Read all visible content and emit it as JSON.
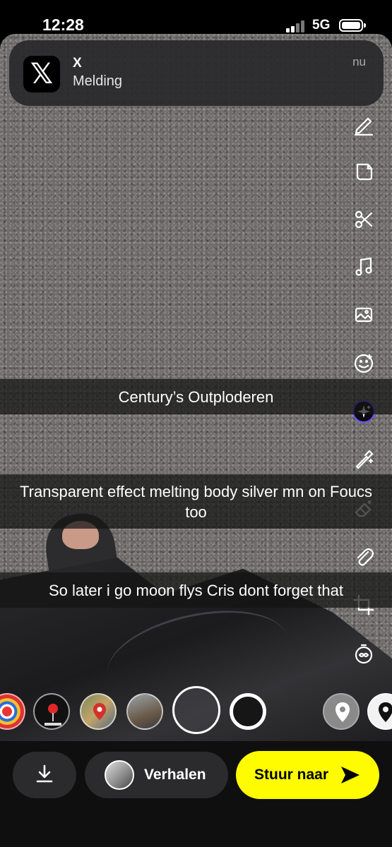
{
  "status_bar": {
    "time": "12:28",
    "network": "5G"
  },
  "notification": {
    "app_icon_glyph": "𝕏",
    "app_name": "X",
    "message": "Melding",
    "time": "nu"
  },
  "tools": [
    {
      "icon": "pencil-icon"
    },
    {
      "icon": "sticker-icon"
    },
    {
      "icon": "scissors-icon"
    },
    {
      "icon": "music-icon"
    },
    {
      "icon": "image-frame-icon"
    },
    {
      "icon": "smiley-icon"
    },
    {
      "icon": "ai-sparkle-icon"
    },
    {
      "icon": "magic-pen-icon"
    },
    {
      "icon": "eraser-icon"
    },
    {
      "icon": "paperclip-icon"
    },
    {
      "icon": "crop-icon"
    },
    {
      "icon": "timer-icon"
    }
  ],
  "captions": [
    "Century’s Outploderen",
    "Transparent effect melting body silver mn on Foucs too",
    "So later i go moon flys Cris dont  forget that"
  ],
  "lenses": [
    {
      "icon": "target-lens-icon"
    },
    {
      "icon": "kano-lens-icon"
    },
    {
      "icon": "map-lens-icon"
    },
    {
      "icon": "photo-lens-icon"
    },
    {
      "icon": "shutter-button"
    },
    {
      "icon": "black-lens-icon"
    },
    {
      "icon": "location-pin-lens-icon"
    },
    {
      "icon": "location-pin-dark-lens-icon"
    }
  ],
  "bottom": {
    "save_icon": "download-icon",
    "stories_label": "Verhalen",
    "send_label": "Stuur naar"
  },
  "colors": {
    "send_button": "#fffc00",
    "background": "#000000"
  }
}
